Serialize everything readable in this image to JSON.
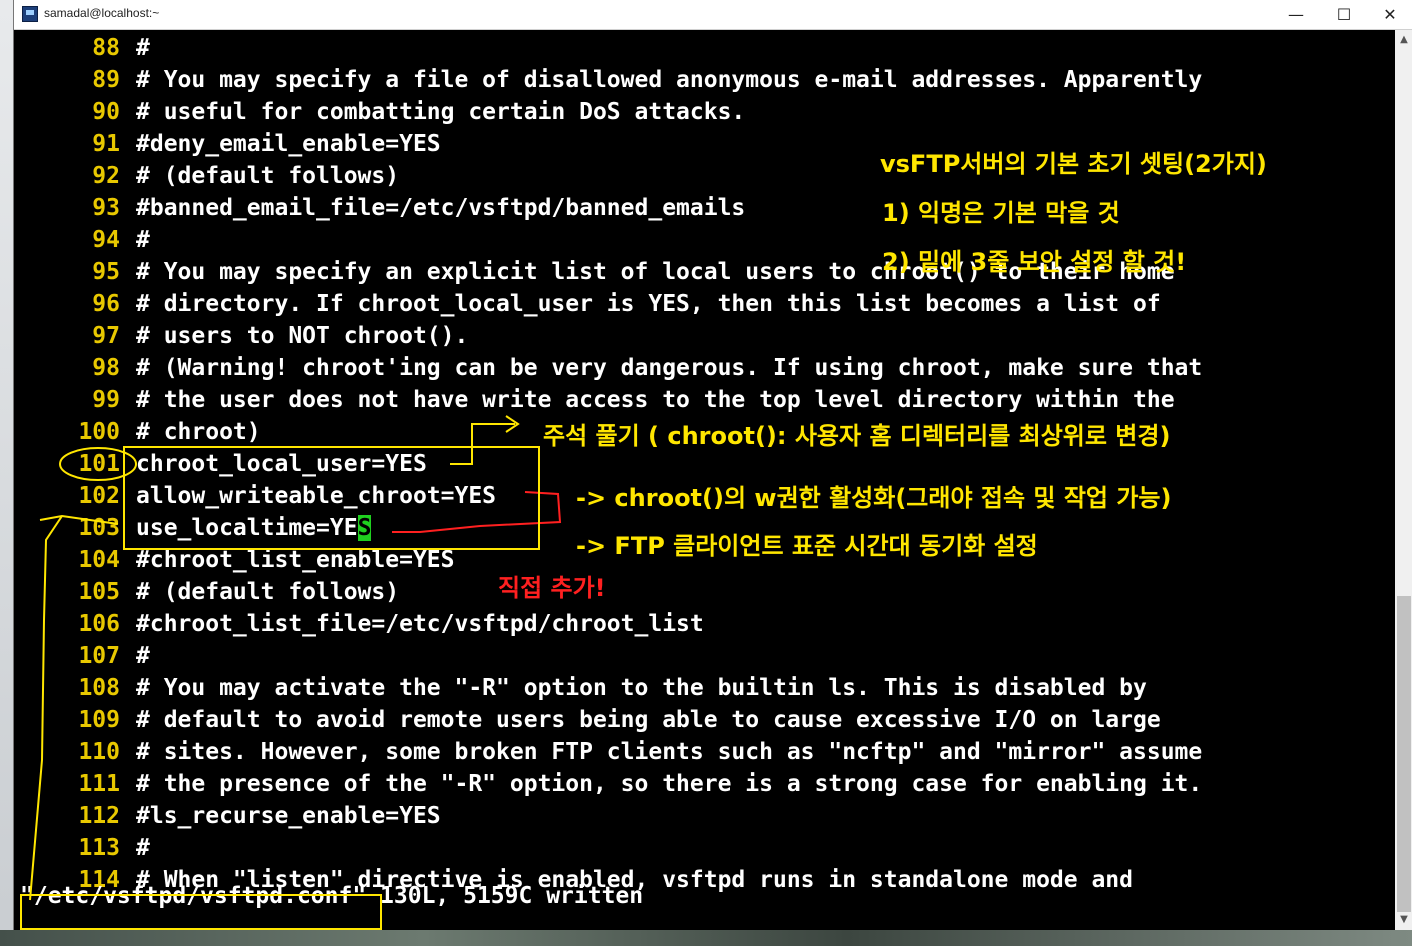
{
  "window": {
    "title": "samadal@localhost:~",
    "minimize_glyph": "—",
    "maximize_glyph": "☐",
    "close_glyph": "✕"
  },
  "terminal": {
    "lines": [
      {
        "num": "88",
        "text": "#"
      },
      {
        "num": "89",
        "text": "# You may specify a file of disallowed anonymous e-mail addresses. Apparently"
      },
      {
        "num": "90",
        "text": "# useful for combatting certain DoS attacks."
      },
      {
        "num": "91",
        "text": "#deny_email_enable=YES"
      },
      {
        "num": "92",
        "text": "# (default follows)"
      },
      {
        "num": "93",
        "text": "#banned_email_file=/etc/vsftpd/banned_emails"
      },
      {
        "num": "94",
        "text": "#"
      },
      {
        "num": "95",
        "text": "# You may specify an explicit list of local users to chroot() to their home"
      },
      {
        "num": "96",
        "text": "# directory. If chroot_local_user is YES, then this list becomes a list of"
      },
      {
        "num": "97",
        "text": "# users to NOT chroot()."
      },
      {
        "num": "98",
        "text": "# (Warning! chroot'ing can be very dangerous. If using chroot, make sure that"
      },
      {
        "num": "99",
        "text": "# the user does not have write access to the top level directory within the"
      },
      {
        "num": "100",
        "text": "# chroot)"
      },
      {
        "num": "101",
        "text": "chroot_local_user=YES"
      },
      {
        "num": "102",
        "text": "allow_writeable_chroot=YES"
      },
      {
        "num": "103",
        "text": "use_localtime=YE"
      },
      {
        "num": "104",
        "text": "#chroot_list_enable=YES"
      },
      {
        "num": "105",
        "text": "# (default follows)"
      },
      {
        "num": "106",
        "text": "#chroot_list_file=/etc/vsftpd/chroot_list"
      },
      {
        "num": "107",
        "text": "#"
      },
      {
        "num": "108",
        "text": "# You may activate the \"-R\" option to the builtin ls. This is disabled by"
      },
      {
        "num": "109",
        "text": "# default to avoid remote users being able to cause excessive I/O on large"
      },
      {
        "num": "110",
        "text": "# sites. However, some broken FTP clients such as \"ncftp\" and \"mirror\" assume"
      },
      {
        "num": "111",
        "text": "# the presence of the \"-R\" option, so there is a strong case for enabling it."
      },
      {
        "num": "112",
        "text": "#ls_recurse_enable=YES"
      },
      {
        "num": "113",
        "text": "#"
      },
      {
        "num": "114",
        "text": "# When \"listen\" directive is enabled, vsftpd runs in standalone mode and"
      }
    ],
    "cursor_char": "S",
    "status_line": "\"/etc/vsftpd/vsftpd.conf\" 130L, 5159C written"
  },
  "annotations": {
    "heading": "vsFTP서버의 기본 초기 셋팅(2가지)",
    "point1": "1) 익명은 기본 막을 것",
    "point2": "2) 밑에 3줄 보안 설정 할 것!",
    "note_chroot": "주석 풀기  ( chroot(): 사용자 홈 디렉터리를 최상위로 변경)",
    "note_writeable": "->  chroot()의 w권한 활성화(그래야 접속 및 작업 가능)",
    "note_localtime": "->  FTP 클라이언트 표준 시간대 동기화 설정",
    "note_added": "직접 추가!"
  },
  "colors": {
    "annotation_yellow": "#ffe600",
    "annotation_red": "#ff2020",
    "line_number": "#e8c800",
    "cursor": "#1fd01f"
  }
}
